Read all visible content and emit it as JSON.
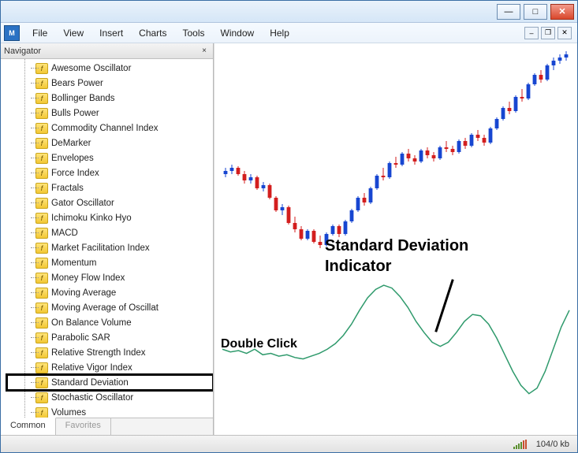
{
  "titlebar": {
    "minimize": "—",
    "maximize": "□",
    "close": "✕"
  },
  "menubar": {
    "items": [
      "File",
      "View",
      "Insert",
      "Charts",
      "Tools",
      "Window",
      "Help"
    ],
    "mdi_minimize": "–",
    "mdi_restore": "❐",
    "mdi_close": "✕"
  },
  "navigator": {
    "title": "Navigator",
    "close": "×",
    "indicators": [
      "Awesome Oscillator",
      "Bears Power",
      "Bollinger Bands",
      "Bulls Power",
      "Commodity Channel Index",
      "DeMarker",
      "Envelopes",
      "Force Index",
      "Fractals",
      "Gator Oscillator",
      "Ichimoku Kinko Hyo",
      "MACD",
      "Market Facilitation Index",
      "Momentum",
      "Money Flow Index",
      "Moving Average",
      "Moving Average of Oscillat",
      "On Balance Volume",
      "Parabolic SAR",
      "Relative Strength Index",
      "Relative Vigor Index",
      "Standard Deviation",
      "Stochastic Oscillator",
      "Volumes"
    ],
    "highlighted_index": 21,
    "tabs": {
      "common": "Common",
      "favorites": "Favorites",
      "active": "common"
    }
  },
  "annotations": {
    "line1": "Standard Deviation",
    "line2": "Indicator",
    "line3": "Double Click"
  },
  "statusbar": {
    "kb": "104/0 kb"
  },
  "chart_data": {
    "type": "line",
    "title": "",
    "series": [
      {
        "name": "Standard Deviation",
        "color": "#2f9a6c",
        "x": [
          0,
          10,
          20,
          30,
          40,
          50,
          60,
          70,
          80,
          90,
          100,
          110,
          120,
          130,
          140,
          150,
          160,
          170,
          180,
          190,
          200,
          210,
          220,
          230,
          240,
          250,
          260,
          270,
          280,
          290,
          300,
          310,
          320,
          330,
          340,
          350,
          360,
          370,
          380,
          390,
          400,
          410,
          420,
          430
        ],
        "values": [
          0.5,
          0.48,
          0.49,
          0.47,
          0.5,
          0.46,
          0.47,
          0.45,
          0.46,
          0.44,
          0.43,
          0.45,
          0.47,
          0.5,
          0.54,
          0.6,
          0.68,
          0.78,
          0.87,
          0.93,
          0.96,
          0.94,
          0.88,
          0.8,
          0.7,
          0.62,
          0.55,
          0.52,
          0.55,
          0.62,
          0.7,
          0.75,
          0.74,
          0.68,
          0.58,
          0.46,
          0.34,
          0.24,
          0.18,
          0.22,
          0.34,
          0.5,
          0.66,
          0.78
        ]
      }
    ],
    "candles": {
      "note": "OHLC estimated from pixels; no axis labels visible",
      "count": 55,
      "colors": {
        "up": "#1746d1",
        "down": "#d31e1e"
      },
      "data": [
        {
          "o": 72,
          "h": 76,
          "l": 70,
          "c": 74
        },
        {
          "o": 74,
          "h": 78,
          "l": 72,
          "c": 76
        },
        {
          "o": 76,
          "h": 77,
          "l": 71,
          "c": 72
        },
        {
          "o": 72,
          "h": 74,
          "l": 66,
          "c": 68
        },
        {
          "o": 68,
          "h": 72,
          "l": 66,
          "c": 70
        },
        {
          "o": 70,
          "h": 71,
          "l": 62,
          "c": 63
        },
        {
          "o": 63,
          "h": 67,
          "l": 61,
          "c": 65
        },
        {
          "o": 65,
          "h": 66,
          "l": 56,
          "c": 57
        },
        {
          "o": 57,
          "h": 58,
          "l": 48,
          "c": 49
        },
        {
          "o": 49,
          "h": 53,
          "l": 46,
          "c": 51
        },
        {
          "o": 51,
          "h": 52,
          "l": 40,
          "c": 41
        },
        {
          "o": 41,
          "h": 45,
          "l": 35,
          "c": 37
        },
        {
          "o": 37,
          "h": 39,
          "l": 30,
          "c": 31
        },
        {
          "o": 31,
          "h": 37,
          "l": 30,
          "c": 36
        },
        {
          "o": 36,
          "h": 37,
          "l": 28,
          "c": 29
        },
        {
          "o": 29,
          "h": 33,
          "l": 25,
          "c": 27
        },
        {
          "o": 27,
          "h": 35,
          "l": 26,
          "c": 34
        },
        {
          "o": 34,
          "h": 40,
          "l": 33,
          "c": 39
        },
        {
          "o": 39,
          "h": 40,
          "l": 32,
          "c": 34
        },
        {
          "o": 34,
          "h": 43,
          "l": 33,
          "c": 42
        },
        {
          "o": 42,
          "h": 50,
          "l": 41,
          "c": 49
        },
        {
          "o": 49,
          "h": 58,
          "l": 48,
          "c": 57
        },
        {
          "o": 57,
          "h": 60,
          "l": 52,
          "c": 54
        },
        {
          "o": 54,
          "h": 64,
          "l": 53,
          "c": 63
        },
        {
          "o": 63,
          "h": 72,
          "l": 62,
          "c": 71
        },
        {
          "o": 71,
          "h": 76,
          "l": 68,
          "c": 70
        },
        {
          "o": 70,
          "h": 80,
          "l": 69,
          "c": 79
        },
        {
          "o": 79,
          "h": 83,
          "l": 76,
          "c": 78
        },
        {
          "o": 78,
          "h": 86,
          "l": 77,
          "c": 85
        },
        {
          "o": 85,
          "h": 88,
          "l": 80,
          "c": 82
        },
        {
          "o": 82,
          "h": 84,
          "l": 78,
          "c": 80
        },
        {
          "o": 80,
          "h": 88,
          "l": 79,
          "c": 87
        },
        {
          "o": 87,
          "h": 89,
          "l": 82,
          "c": 84
        },
        {
          "o": 84,
          "h": 86,
          "l": 80,
          "c": 82
        },
        {
          "o": 82,
          "h": 90,
          "l": 81,
          "c": 89
        },
        {
          "o": 89,
          "h": 93,
          "l": 86,
          "c": 88
        },
        {
          "o": 88,
          "h": 90,
          "l": 84,
          "c": 86
        },
        {
          "o": 86,
          "h": 94,
          "l": 85,
          "c": 93
        },
        {
          "o": 93,
          "h": 95,
          "l": 88,
          "c": 90
        },
        {
          "o": 90,
          "h": 98,
          "l": 89,
          "c": 97
        },
        {
          "o": 97,
          "h": 100,
          "l": 93,
          "c": 95
        },
        {
          "o": 95,
          "h": 97,
          "l": 90,
          "c": 92
        },
        {
          "o": 92,
          "h": 102,
          "l": 91,
          "c": 101
        },
        {
          "o": 101,
          "h": 108,
          "l": 100,
          "c": 107
        },
        {
          "o": 107,
          "h": 115,
          "l": 106,
          "c": 114
        },
        {
          "o": 114,
          "h": 118,
          "l": 110,
          "c": 112
        },
        {
          "o": 112,
          "h": 122,
          "l": 111,
          "c": 121
        },
        {
          "o": 121,
          "h": 126,
          "l": 118,
          "c": 120
        },
        {
          "o": 120,
          "h": 130,
          "l": 119,
          "c": 129
        },
        {
          "o": 129,
          "h": 136,
          "l": 128,
          "c": 135
        },
        {
          "o": 135,
          "h": 138,
          "l": 130,
          "c": 132
        },
        {
          "o": 132,
          "h": 142,
          "l": 131,
          "c": 141
        },
        {
          "o": 141,
          "h": 146,
          "l": 138,
          "c": 144
        },
        {
          "o": 144,
          "h": 148,
          "l": 142,
          "c": 146
        },
        {
          "o": 146,
          "h": 150,
          "l": 144,
          "c": 148
        }
      ]
    }
  }
}
